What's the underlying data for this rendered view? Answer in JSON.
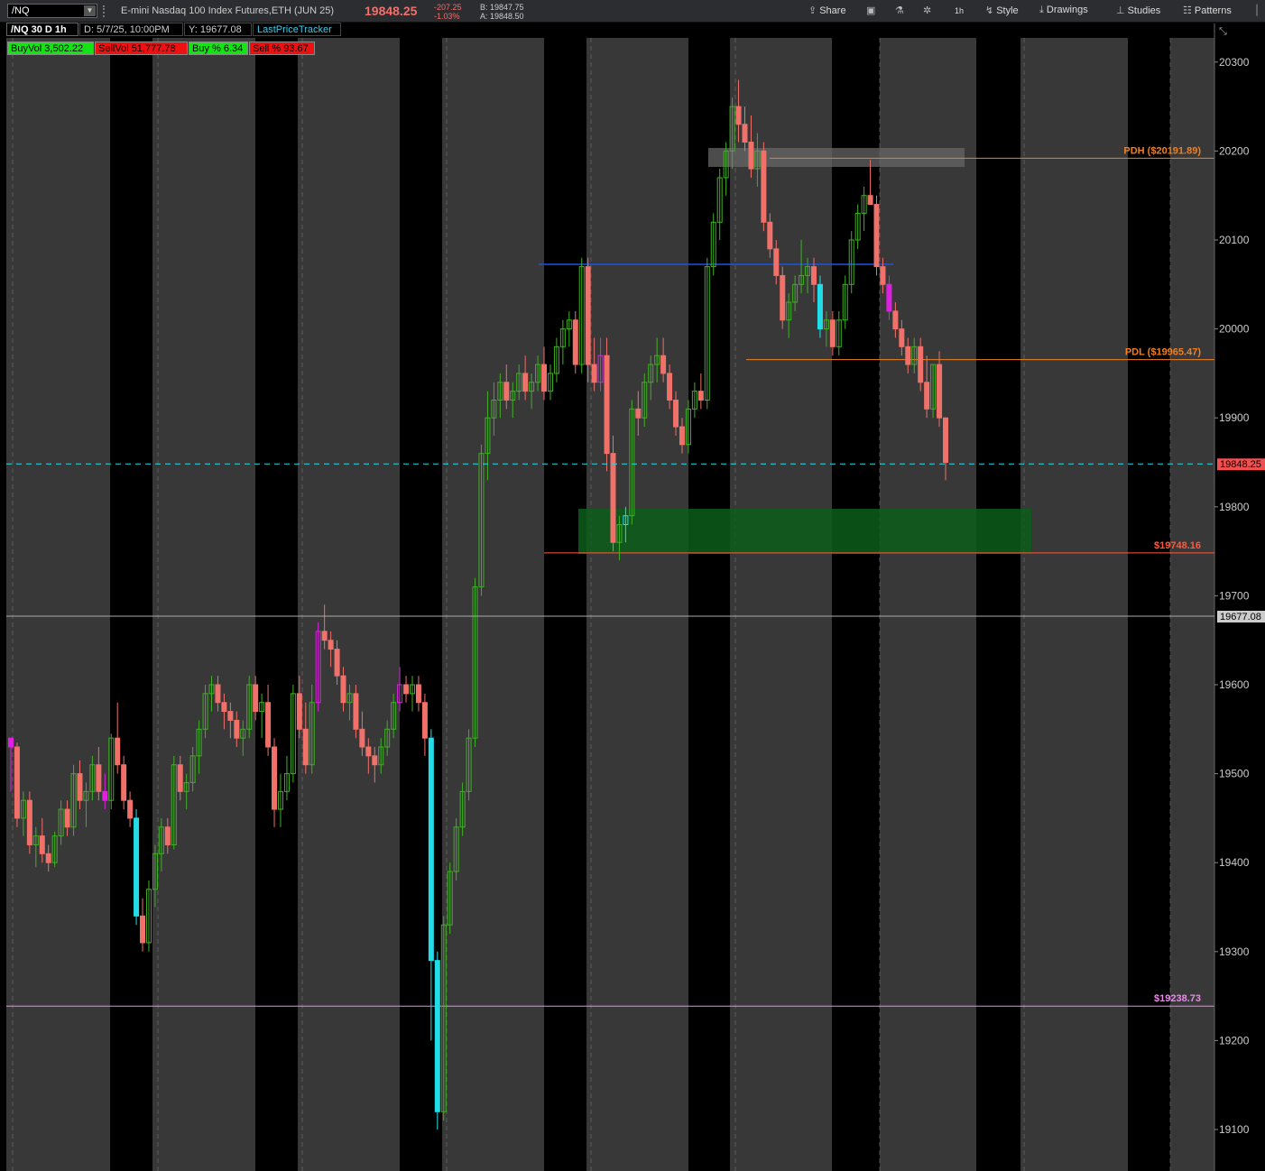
{
  "toolbar": {
    "symbol": "/NQ",
    "description": "E-mini Nasdaq 100 Index Futures,ETH (JUN 25)",
    "last": "19848.25",
    "net_change": "-207.25",
    "pct_change": "-1.03%",
    "bid": "B: 19847.75",
    "ask": "A: 19848.50",
    "share": "Share",
    "timeframe": "1h",
    "style": "Style",
    "drawings": "Drawings",
    "studies": "Studies",
    "patterns": "Patterns"
  },
  "studyline": {
    "chart_label": "/NQ 30 D 1h",
    "date_label": "D: 5/7/25, 10:00PM",
    "y_label": "Y: 19677.08",
    "tracker": "LastPriceTracker"
  },
  "labels": {
    "buyvol": "BuyVol 3,502.22",
    "sellvol": "SellVol 51,777.78",
    "buypct": "Buy % 6.34",
    "sellpct": "Sell % 93.67"
  },
  "colors": {
    "up": "#3fb024",
    "down": "#f0706a",
    "magenta": "#e020e0",
    "cyan": "#22dde8",
    "session": "#383838",
    "orange": "#f08020",
    "blue": "#2050e0",
    "pink": "#ee88ee"
  },
  "chart_data": {
    "type": "candlestick",
    "ylim": [
      19050,
      20330
    ],
    "y_ticks": [
      "20300",
      "20200",
      "20100",
      "20000",
      "19900",
      "19800",
      "19700",
      "19600",
      "19500",
      "19400",
      "19300",
      "19200",
      "19100"
    ],
    "price_tags": {
      "last": "19848.25",
      "crosshair": "19677.08"
    },
    "levels": [
      {
        "name": "PDH",
        "label": "PDH ($20191.89)",
        "value": 20191.89
      },
      {
        "name": "PDL",
        "label": "PDL ($19965.47)",
        "value": 19965.47
      },
      {
        "name": "low-level",
        "label": "$19748.16",
        "value": 19748.16
      },
      {
        "name": "weekly-low",
        "label": "$19238.73",
        "value": 19238.73
      }
    ],
    "candles": [
      [
        19540,
        19540,
        19480,
        19530
      ],
      [
        19530,
        19535,
        19440,
        19450
      ],
      [
        19450,
        19480,
        19430,
        19470
      ],
      [
        19470,
        19480,
        19410,
        19420
      ],
      [
        19420,
        19440,
        19395,
        19430
      ],
      [
        19430,
        19450,
        19400,
        19410
      ],
      [
        19410,
        19420,
        19390,
        19400
      ],
      [
        19400,
        19435,
        19395,
        19430
      ],
      [
        19430,
        19470,
        19420,
        19460
      ],
      [
        19460,
        19470,
        19430,
        19440
      ],
      [
        19440,
        19510,
        19430,
        19500
      ],
      [
        19500,
        19515,
        19460,
        19470
      ],
      [
        19470,
        19490,
        19440,
        19480
      ],
      [
        19480,
        19520,
        19470,
        19510
      ],
      [
        19510,
        19530,
        19470,
        19480
      ],
      [
        19480,
        19500,
        19460,
        19470
      ],
      [
        19470,
        19545,
        19460,
        19540
      ],
      [
        19540,
        19580,
        19500,
        19510
      ],
      [
        19510,
        19520,
        19460,
        19470
      ],
      [
        19470,
        19480,
        19440,
        19450
      ],
      [
        19450,
        19460,
        19330,
        19340
      ],
      [
        19340,
        19360,
        19300,
        19310
      ],
      [
        19310,
        19380,
        19300,
        19370
      ],
      [
        19370,
        19420,
        19350,
        19410
      ],
      [
        19410,
        19450,
        19390,
        19440
      ],
      [
        19440,
        19450,
        19410,
        19420
      ],
      [
        19420,
        19520,
        19415,
        19510
      ],
      [
        19510,
        19520,
        19470,
        19480
      ],
      [
        19480,
        19500,
        19460,
        19490
      ],
      [
        19490,
        19530,
        19480,
        19520
      ],
      [
        19520,
        19560,
        19500,
        19550
      ],
      [
        19550,
        19600,
        19540,
        19590
      ],
      [
        19590,
        19610,
        19570,
        19600
      ],
      [
        19600,
        19610,
        19570,
        19580
      ],
      [
        19580,
        19590,
        19550,
        19570
      ],
      [
        19570,
        19580,
        19540,
        19560
      ],
      [
        19560,
        19570,
        19530,
        19540
      ],
      [
        19540,
        19560,
        19520,
        19550
      ],
      [
        19550,
        19610,
        19540,
        19600
      ],
      [
        19600,
        19610,
        19560,
        19570
      ],
      [
        19570,
        19590,
        19540,
        19580
      ],
      [
        19580,
        19600,
        19520,
        19530
      ],
      [
        19530,
        19540,
        19440,
        19460
      ],
      [
        19460,
        19500,
        19440,
        19480
      ],
      [
        19480,
        19520,
        19470,
        19500
      ],
      [
        19500,
        19600,
        19490,
        19590
      ],
      [
        19590,
        19610,
        19540,
        19550
      ],
      [
        19550,
        19580,
        19500,
        19510
      ],
      [
        19510,
        19600,
        19500,
        19580
      ],
      [
        19580,
        19670,
        19570,
        19660
      ],
      [
        19660,
        19690,
        19640,
        19650
      ],
      [
        19650,
        19660,
        19620,
        19640
      ],
      [
        19640,
        19650,
        19600,
        19610
      ],
      [
        19610,
        19620,
        19570,
        19580
      ],
      [
        19580,
        19600,
        19560,
        19590
      ],
      [
        19590,
        19600,
        19540,
        19550
      ],
      [
        19550,
        19570,
        19520,
        19530
      ],
      [
        19530,
        19540,
        19500,
        19520
      ],
      [
        19520,
        19530,
        19490,
        19510
      ],
      [
        19510,
        19540,
        19500,
        19530
      ],
      [
        19530,
        19560,
        19520,
        19550
      ],
      [
        19550,
        19590,
        19540,
        19580
      ],
      [
        19580,
        19620,
        19570,
        19600
      ],
      [
        19600,
        19610,
        19580,
        19590
      ],
      [
        19590,
        19610,
        19570,
        19600
      ],
      [
        19600,
        19610,
        19570,
        19580
      ],
      [
        19580,
        19590,
        19520,
        19540
      ],
      [
        19540,
        19550,
        19200,
        19290
      ],
      [
        19290,
        19300,
        19100,
        19120
      ],
      [
        19120,
        19340,
        19110,
        19330
      ],
      [
        19330,
        19400,
        19320,
        19390
      ],
      [
        19390,
        19450,
        19380,
        19440
      ],
      [
        19440,
        19490,
        19430,
        19480
      ],
      [
        19480,
        19550,
        19470,
        19540
      ],
      [
        19540,
        19720,
        19530,
        19710
      ],
      [
        19710,
        19870,
        19700,
        19860
      ],
      [
        19860,
        19930,
        19830,
        19900
      ],
      [
        19900,
        19940,
        19880,
        19920
      ],
      [
        19920,
        19950,
        19900,
        19940
      ],
      [
        19940,
        19960,
        19910,
        19920
      ],
      [
        19920,
        19940,
        19900,
        19930
      ],
      [
        19930,
        19960,
        19920,
        19950
      ],
      [
        19950,
        19970,
        19920,
        19930
      ],
      [
        19930,
        19950,
        19910,
        19940
      ],
      [
        19940,
        19970,
        19930,
        19960
      ],
      [
        19960,
        19980,
        19920,
        19930
      ],
      [
        19930,
        19960,
        19920,
        19950
      ],
      [
        19950,
        19990,
        19940,
        19980
      ],
      [
        19980,
        20010,
        19960,
        20000
      ],
      [
        20000,
        20020,
        19980,
        20010
      ],
      [
        20010,
        20020,
        19950,
        19960
      ],
      [
        19960,
        20080,
        19950,
        20070
      ],
      [
        20070,
        20080,
        19940,
        19960
      ],
      [
        19960,
        19990,
        19930,
        19940
      ],
      [
        19940,
        19990,
        19930,
        19970
      ],
      [
        19970,
        19990,
        19840,
        19860
      ],
      [
        19860,
        19880,
        19750,
        19760
      ],
      [
        19760,
        19790,
        19740,
        19780
      ],
      [
        19780,
        19800,
        19760,
        19790
      ],
      [
        19790,
        19920,
        19780,
        19910
      ],
      [
        19910,
        19930,
        19880,
        19900
      ],
      [
        19900,
        19950,
        19890,
        19940
      ],
      [
        19940,
        19970,
        19920,
        19960
      ],
      [
        19960,
        19990,
        19940,
        19970
      ],
      [
        19970,
        19990,
        19940,
        19950
      ],
      [
        19950,
        19960,
        19910,
        19920
      ],
      [
        19920,
        19930,
        19880,
        19890
      ],
      [
        19890,
        19900,
        19860,
        19870
      ],
      [
        19870,
        19920,
        19860,
        19910
      ],
      [
        19910,
        19940,
        19900,
        19930
      ],
      [
        19930,
        19950,
        19910,
        19920
      ],
      [
        19920,
        20080,
        19910,
        20070
      ],
      [
        20070,
        20130,
        20060,
        20120
      ],
      [
        20120,
        20180,
        20100,
        20170
      ],
      [
        20170,
        20210,
        20150,
        20200
      ],
      [
        20200,
        20260,
        20180,
        20250
      ],
      [
        20250,
        20280,
        20210,
        20230
      ],
      [
        20230,
        20250,
        20200,
        20210
      ],
      [
        20210,
        20240,
        20170,
        20180
      ],
      [
        20180,
        20220,
        20160,
        20200
      ],
      [
        20200,
        20210,
        20110,
        20120
      ],
      [
        20120,
        20130,
        20080,
        20090
      ],
      [
        20090,
        20100,
        20050,
        20060
      ],
      [
        20060,
        20070,
        20000,
        20010
      ],
      [
        20010,
        20040,
        19990,
        20030
      ],
      [
        20030,
        20060,
        20020,
        20050
      ],
      [
        20050,
        20100,
        20040,
        20060
      ],
      [
        20060,
        20080,
        20040,
        20070
      ],
      [
        20070,
        20080,
        20030,
        20050
      ],
      [
        20050,
        20060,
        19990,
        20000
      ],
      [
        20000,
        20020,
        19980,
        20010
      ],
      [
        20010,
        20020,
        19970,
        19980
      ],
      [
        19980,
        20020,
        19970,
        20010
      ],
      [
        20010,
        20060,
        20000,
        20050
      ],
      [
        20050,
        20110,
        20040,
        20100
      ],
      [
        20100,
        20140,
        20090,
        20130
      ],
      [
        20130,
        20160,
        20110,
        20150
      ],
      [
        20150,
        20190,
        20140,
        20140
      ],
      [
        20140,
        20150,
        20060,
        20070
      ],
      [
        20070,
        20080,
        20040,
        20050
      ],
      [
        20050,
        20060,
        20010,
        20020
      ],
      [
        20020,
        20030,
        19990,
        20000
      ],
      [
        20000,
        20010,
        19970,
        19980
      ],
      [
        19980,
        19990,
        19950,
        19960
      ],
      [
        19960,
        19990,
        19950,
        19980
      ],
      [
        19980,
        19990,
        19930,
        19940
      ],
      [
        19940,
        19970,
        19900,
        19910
      ],
      [
        19910,
        19960,
        19900,
        19960
      ],
      [
        19960,
        19975,
        19890,
        19900
      ],
      [
        19900,
        19900,
        19830,
        19850
      ]
    ]
  }
}
